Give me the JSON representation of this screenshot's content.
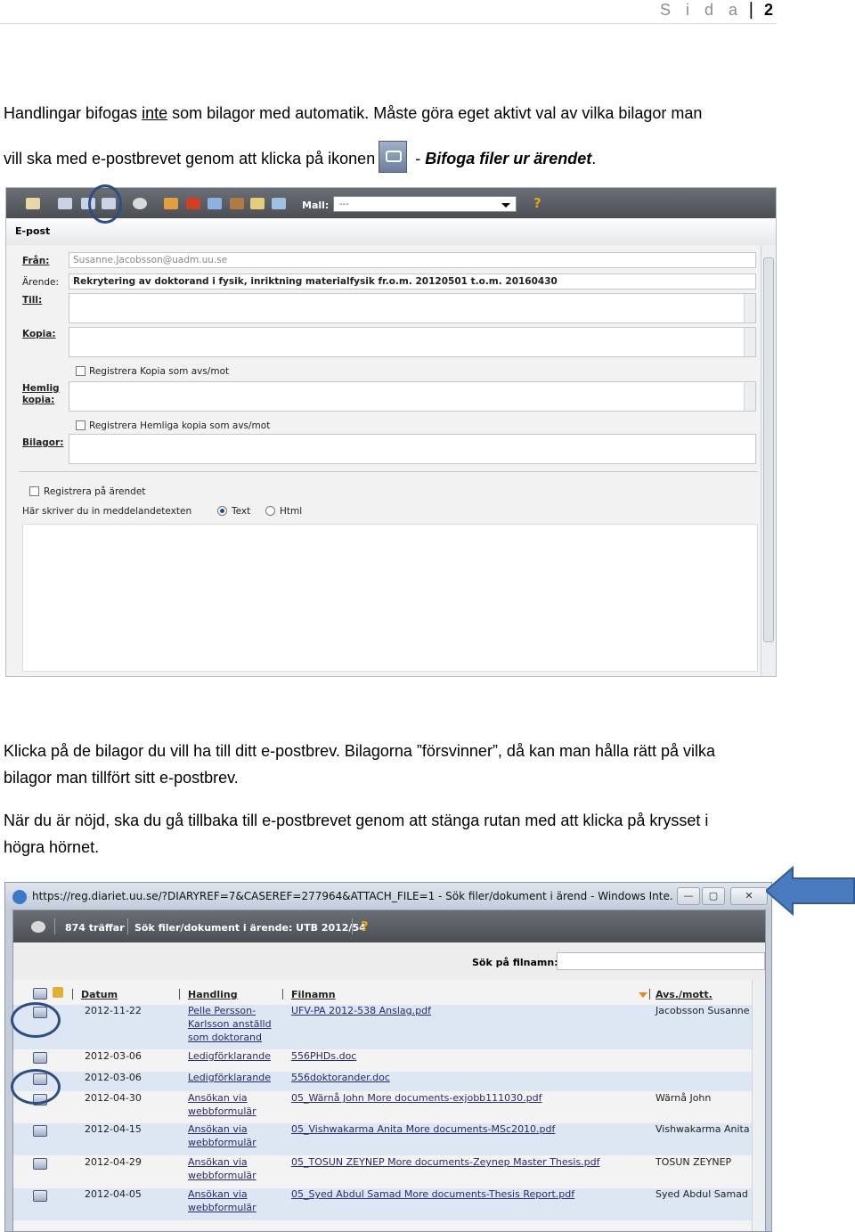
{
  "header": {
    "sida": "S i d a",
    "separator": "|",
    "page_number": "2"
  },
  "intro": {
    "line1_a": "Handlingar bifogas ",
    "line1_u": "inte",
    "line1_b": " som bilagor med automatik. Måste göra eget aktivt val av vilka bilagor man",
    "line2_a": "vill ska med e-postbrevet genom att klicka på ikonen",
    "line2_dash": " - ",
    "line2_bi": "Bifoga filer ur ärendet",
    "line2_end": "."
  },
  "email_window": {
    "mall_label": "Mall:",
    "mall_value": "---",
    "help": "?",
    "title": "E-post",
    "from_label": "Från:",
    "from_value": "Susanne.Jacobsson@uadm.uu.se",
    "subject_label": "Ärende:",
    "subject_value": "Rekrytering av doktorand i fysik, inriktning materialfysik fr.o.m. 20120501 t.o.m. 20160430",
    "to_label": "Till:",
    "cc_label": "Kopia:",
    "cc_register": "Registrera Kopia som avs/mot",
    "bcc_label_1": "Hemlig",
    "bcc_label_2": "kopia:",
    "bcc_register": "Registrera Hemliga kopia som avs/mot",
    "attachments_label": "Bilagor:",
    "register_case": "Registrera på ärendet",
    "message_hint": "Här skriver du in meddelandetexten",
    "format_text": "Text",
    "format_html": "Html",
    "icons": [
      "envelope-icon",
      "attach-icon",
      "attach-icon",
      "attach-case-icon",
      "search-icon",
      "person-icon",
      "person-icon",
      "card-icon",
      "person-icon",
      "folder-icon",
      "book-icon"
    ]
  },
  "mid_text": {
    "p1_line1": "Klicka på de bilagor du vill ha till ditt e-postbrev. Bilagorna ”försvinner”, då kan man hålla rätt på vilka",
    "p1_line2": "bilagor man tillfört sitt e-postbrev.",
    "p2_line1": "När du är nöjd, ska du gå tillbaka till e-postbrevet genom att stänga rutan med att klicka på krysset i",
    "p2_line2": "högra hörnet."
  },
  "browser_window": {
    "title": "https://reg.diariet.uu.se/?DIARYREF=7&CASEREF=277964&ATTACH_FILE=1 - Sök filer/dokument i ärend - Windows Inte...",
    "minimize": "—",
    "maximize": "▢",
    "close": "✕",
    "hits": "874 träffar",
    "search_title": "Sök filer/dokument i ärende: UTB 2012/54",
    "help": "?",
    "search_label": "Sök på filnamn:",
    "columns": {
      "date": "Datum",
      "handling": "Handling",
      "filename": "Filnamn",
      "sender": "Avs./mott."
    },
    "rows": [
      {
        "date": "2012-11-22",
        "handling": [
          "Pelle Persson-",
          "Karlsson anställd",
          "som doktorand"
        ],
        "file": "UFV-PA 2012-538 Anslag.pdf",
        "sender": "Jacobsson Susanne"
      },
      {
        "date": "2012-03-06",
        "handling": [
          "Ledigförklarande"
        ],
        "file": "556PHDs.doc",
        "sender": ""
      },
      {
        "date": "2012-03-06",
        "handling": [
          "Ledigförklarande"
        ],
        "file": "556doktorander.doc",
        "sender": ""
      },
      {
        "date": "2012-04-30",
        "handling": [
          "Ansökan via",
          "webbformulär"
        ],
        "file": "05_Wärnå John More documents-exjobb111030.pdf",
        "sender": "Wärnå John"
      },
      {
        "date": "2012-04-15",
        "handling": [
          "Ansökan via",
          "webbformulär"
        ],
        "file": "05_Vishwakarma Anita More documents-MSc2010.pdf",
        "sender": "Vishwakarma Anita"
      },
      {
        "date": "2012-04-29",
        "handling": [
          "Ansökan via",
          "webbformulär"
        ],
        "file": "05_TOSUN ZEYNEP More documents-Zeynep Master Thesis.pdf",
        "sender": "TOSUN ZEYNEP"
      },
      {
        "date": "2012-04-05",
        "handling": [
          "Ansökan via",
          "webbformulär"
        ],
        "file": "05_Syed Abdul Samad More documents-Thesis Report.pdf",
        "sender": "Syed Abdul Samad"
      }
    ]
  },
  "colors": {
    "highlight_circle": "#2c4d85",
    "arrow": "#4a7bbf",
    "toolbar_dark": "#4b4f55"
  }
}
